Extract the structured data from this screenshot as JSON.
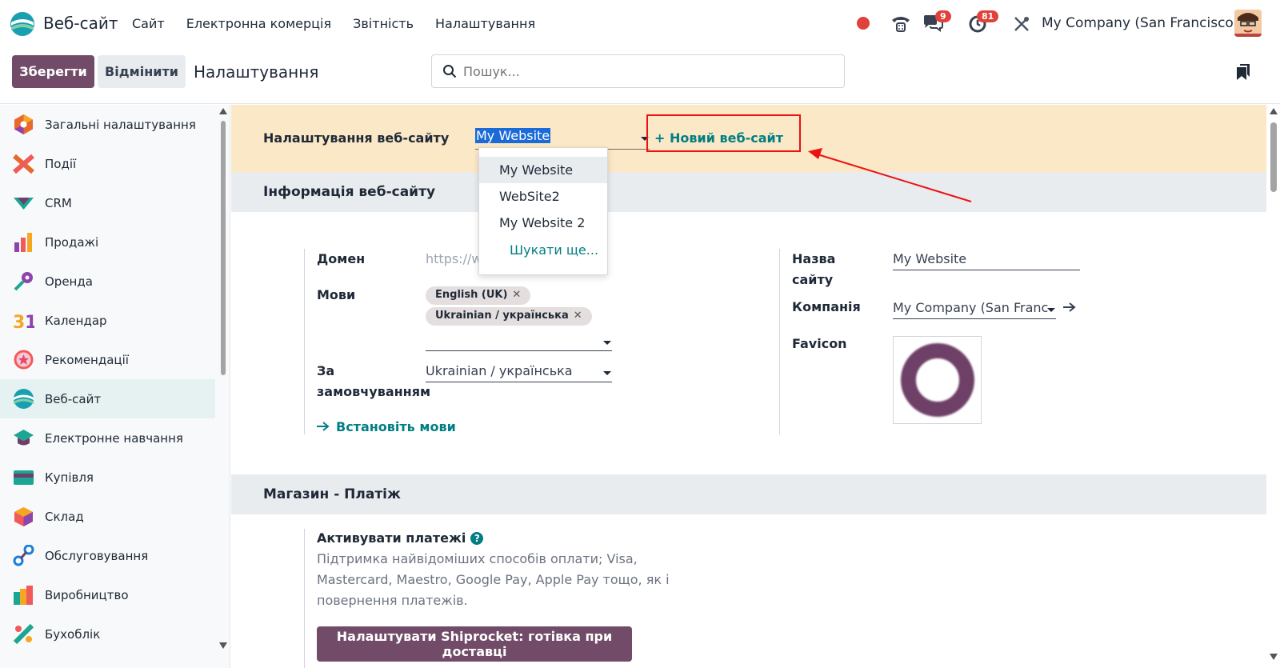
{
  "topnav": {
    "app_name": "Веб-сайт",
    "menu": [
      "Сайт",
      "Електронна комерція",
      "Звітність",
      "Налаштування"
    ],
    "messages_badge": "9",
    "activity_badge": "81",
    "company": "My Company (San Francisco)"
  },
  "control_panel": {
    "save_label": "Зберегти",
    "cancel_label": "Відмінити",
    "title": "Налаштування",
    "search_placeholder": "Пошук..."
  },
  "sidebar": {
    "items": [
      {
        "label": "Загальні налаштування",
        "icon": "general-settings-icon"
      },
      {
        "label": "Події",
        "icon": "events-icon"
      },
      {
        "label": "CRM",
        "icon": "crm-icon"
      },
      {
        "label": "Продажі",
        "icon": "sales-icon"
      },
      {
        "label": "Оренда",
        "icon": "rental-icon"
      },
      {
        "label": "Календар",
        "icon": "calendar-icon"
      },
      {
        "label": "Рекомендації",
        "icon": "referrals-icon"
      },
      {
        "label": "Веб-сайт",
        "icon": "website-icon",
        "active": true
      },
      {
        "label": "Електронне навчання",
        "icon": "elearning-icon"
      },
      {
        "label": "Купівля",
        "icon": "purchase-icon"
      },
      {
        "label": "Склад",
        "icon": "inventory-icon"
      },
      {
        "label": "Обслуговування",
        "icon": "maintenance-icon"
      },
      {
        "label": "Виробництво",
        "icon": "manufacturing-icon"
      },
      {
        "label": "Бухоблік",
        "icon": "accounting-icon"
      }
    ]
  },
  "website_settings": {
    "label": "Налаштування веб-сайту",
    "selected": "My Website",
    "new_site": "+ Новий веб-сайт",
    "dropdown": {
      "options": [
        "My Website",
        "WebSite2",
        "My Website 2"
      ],
      "search_more": "Шукати ще..."
    }
  },
  "info_section": {
    "title": "Інформація веб-сайту",
    "domain_label": "Домен",
    "domain_placeholder": "https://w",
    "languages_label": "Мови",
    "languages": [
      "English (UK)",
      "Ukrainian / українська"
    ],
    "default_label_1": "За",
    "default_label_2": "замовчуванням",
    "default_language": "Ukrainian / українська",
    "install_languages": "Встановіть мови",
    "site_name_label_1": "Назва",
    "site_name_label_2": "сайту",
    "site_name": "My Website",
    "company_label": "Компанія",
    "company": "My Company (San Franc",
    "favicon_label": "Favicon"
  },
  "payment_section": {
    "title": "Магазин - Платіж",
    "activate_label": "Активувати платежі",
    "help": "?",
    "description": "Підтримка найвідоміших способів оплати; Visa, Mastercard, Maestro, Google Pay, Apple Pay тощо, як і повернення платежів.",
    "shiprocket_button": "Налаштувати Shiprocket: готівка при доставці"
  },
  "colors": {
    "brand": "#714b67",
    "teal": "#017e84",
    "banner": "#fbe8c6",
    "annotation": "#e11"
  }
}
